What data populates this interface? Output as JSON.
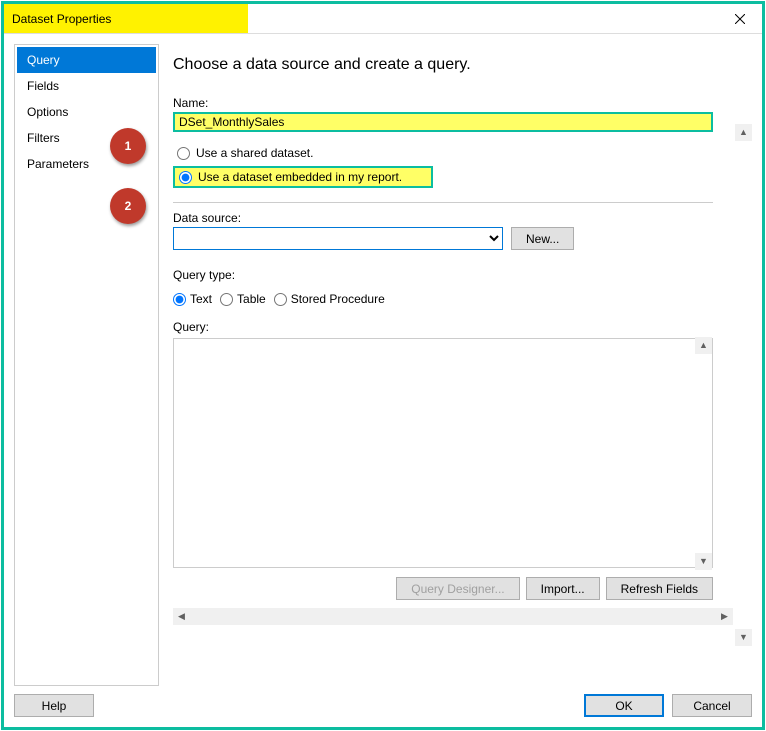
{
  "window": {
    "title": "Dataset Properties"
  },
  "sidebar": {
    "items": [
      {
        "label": "Query",
        "active": true
      },
      {
        "label": "Fields",
        "active": false
      },
      {
        "label": "Options",
        "active": false
      },
      {
        "label": "Filters",
        "active": false
      },
      {
        "label": "Parameters",
        "active": false
      }
    ]
  },
  "heading": "Choose a data source and create a query.",
  "labels": {
    "name": "Name:",
    "dataSource": "Data source:",
    "queryType": "Query type:",
    "query": "Query:"
  },
  "name": {
    "value": "DSet_MonthlySales"
  },
  "datasetOptions": {
    "shared": "Use a shared dataset.",
    "embedded": "Use a dataset embedded in my report."
  },
  "buttons": {
    "new": "New...",
    "queryDesigner": "Query Designer...",
    "import": "Import...",
    "refresh": "Refresh Fields",
    "help": "Help",
    "ok": "OK",
    "cancel": "Cancel"
  },
  "queryTypes": {
    "text": "Text",
    "table": "Table",
    "sp": "Stored Procedure"
  },
  "callouts": {
    "one": "1",
    "two": "2"
  }
}
